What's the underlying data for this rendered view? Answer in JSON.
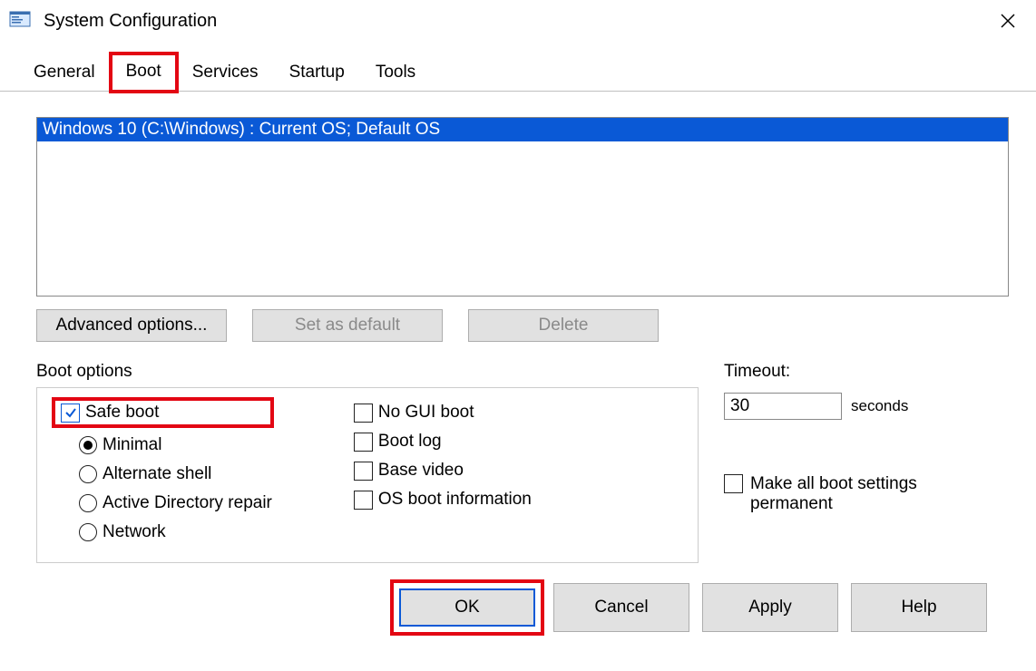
{
  "window": {
    "title": "System Configuration"
  },
  "tabs": {
    "general": "General",
    "boot": "Boot",
    "services": "Services",
    "startup": "Startup",
    "tools": "Tools",
    "active": "boot"
  },
  "osList": {
    "selected": "Windows 10 (C:\\Windows) : Current OS; Default OS"
  },
  "buttons": {
    "advanced": "Advanced options...",
    "setDefault": "Set as default",
    "delete": "Delete"
  },
  "bootOptions": {
    "groupLabel": "Boot options",
    "safeBoot": {
      "label": "Safe boot",
      "checked": true
    },
    "radios": {
      "minimal": "Minimal",
      "altShell": "Alternate shell",
      "adRepair": "Active Directory repair",
      "network": "Network",
      "selected": "minimal"
    },
    "right": {
      "noGui": {
        "label": "No GUI boot",
        "checked": false
      },
      "bootLog": {
        "label": "Boot log",
        "checked": false
      },
      "baseVideo": {
        "label": "Base video",
        "checked": false
      },
      "osBootInfo": {
        "label": "OS boot information",
        "checked": false
      }
    }
  },
  "timeout": {
    "label": "Timeout:",
    "value": "30",
    "unit": "seconds"
  },
  "permanent": {
    "label": "Make all boot settings permanent",
    "checked": false
  },
  "footer": {
    "ok": "OK",
    "cancel": "Cancel",
    "apply": "Apply",
    "help": "Help"
  }
}
